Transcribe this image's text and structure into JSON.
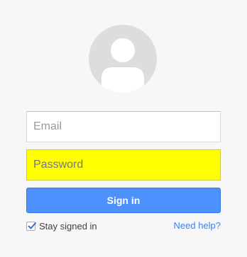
{
  "avatar": {
    "icon": "default-user-icon"
  },
  "form": {
    "email_placeholder": "Email",
    "password_placeholder": "Password",
    "password_highlight_color": "#ffff00",
    "sign_in_label": "Sign in",
    "sign_in_color": "#4d90fe",
    "stay_signed_in_label": "Stay signed in",
    "stay_signed_in_checked": true,
    "need_help_label": "Need help?",
    "link_color": "#427fed"
  }
}
